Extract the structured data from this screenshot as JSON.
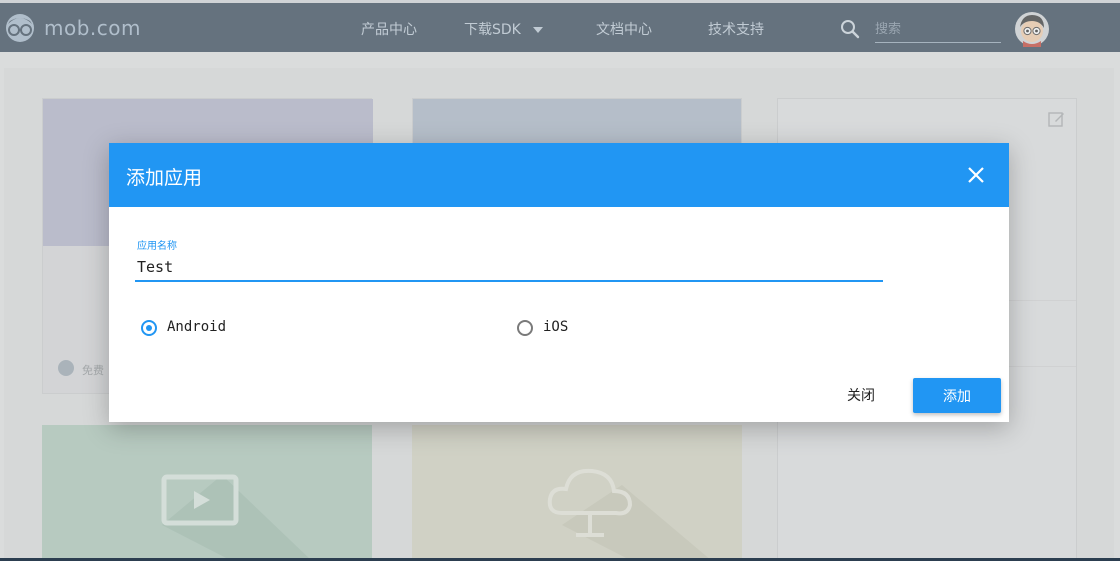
{
  "header": {
    "logo_text": "mob.com",
    "nav": [
      {
        "label": "产品中心"
      },
      {
        "label": "下载SDK"
      },
      {
        "label": "文档中心"
      },
      {
        "label": "技术支持"
      }
    ],
    "search": {
      "placeholder": "搜索",
      "value": ""
    },
    "icons": {
      "search": "search-icon",
      "avatar": "avatar",
      "dropdown": "chevron-down-icon"
    }
  },
  "background": {
    "free_label": "免费"
  },
  "dialog": {
    "title": "添加应用",
    "field_label": "应用名称",
    "field_value": "Test",
    "platforms": [
      {
        "label": "Android",
        "checked": true
      },
      {
        "label": "iOS",
        "checked": false
      }
    ],
    "close_label": "关闭",
    "add_label": "添加"
  },
  "colors": {
    "header_bg": "#2c3e50",
    "accent": "#2196f3"
  }
}
